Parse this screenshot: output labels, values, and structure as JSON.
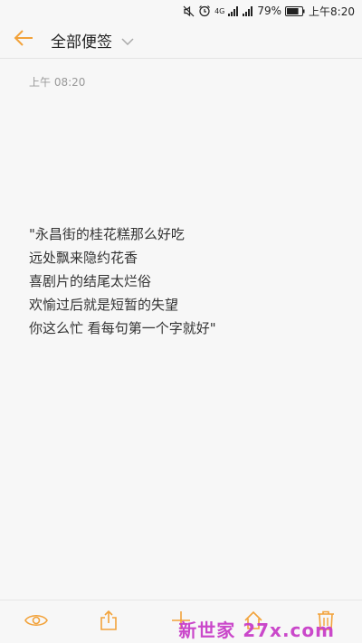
{
  "status_bar": {
    "network": "4G",
    "battery_percent": "79%",
    "time": "上午8:20",
    "battery_level": 0.79
  },
  "header": {
    "title": "全部便签",
    "back_icon": "arrow-left-icon",
    "dropdown_icon": "chevron-down-icon"
  },
  "note": {
    "timestamp": "上午 08:20",
    "lines": [
      "\"永昌街的桂花糕那么好吃",
      "远处飘来隐约花香",
      "喜剧片的结尾太烂俗",
      "欢愉过后就是短暂的失望",
      "你这么忙 看每句第一个字就好\""
    ]
  },
  "toolbar": {
    "icons": [
      "eye-icon",
      "share-icon",
      "plus-icon",
      "home-icon",
      "trash-icon"
    ]
  },
  "watermark": {
    "text": "新世家 27x.com"
  },
  "colors": {
    "accent": "#f2a23a",
    "background": "#f7f7f7",
    "text": "#333333",
    "muted": "#999999",
    "watermark": "#c83fc8"
  }
}
